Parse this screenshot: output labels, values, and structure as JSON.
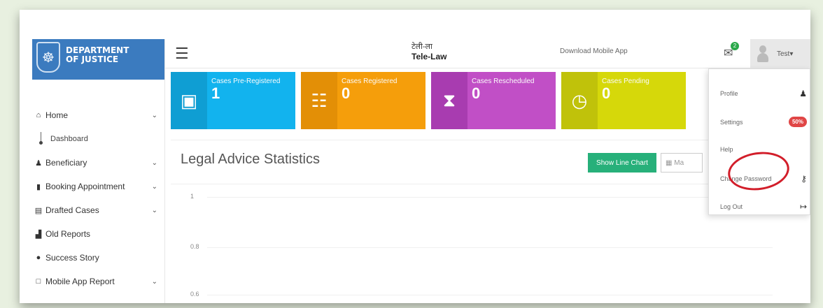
{
  "sidebar": {
    "logo_line1": "DEPARTMENT",
    "logo_line2": "OF JUSTICE",
    "items": [
      {
        "label": "Home",
        "icon": "home-icon",
        "glyph": "⌂",
        "chevron": true
      },
      {
        "label": "Beneficiary",
        "icon": "user-icon",
        "glyph": "♟",
        "chevron": true
      },
      {
        "label": "Booking Appointment",
        "icon": "bookmark-icon",
        "glyph": "▮",
        "chevron": true
      },
      {
        "label": "Drafted Cases",
        "icon": "book-icon",
        "glyph": "▤",
        "chevron": true
      },
      {
        "label": "Old Reports",
        "icon": "bar-chart-icon",
        "glyph": "▟",
        "chevron": false
      },
      {
        "label": "Success Story",
        "icon": "check-circle-icon",
        "glyph": "●",
        "chevron": false
      },
      {
        "label": "Mobile App Report",
        "icon": "square-icon",
        "glyph": "□",
        "chevron": true
      }
    ],
    "sub_item": "Dashboard"
  },
  "topbar": {
    "brand_hi": "टेली-ला",
    "brand_en": "Tele-Law",
    "download_app": "Download Mobile App",
    "mail_count": "2",
    "user_name": "Test▾"
  },
  "cards": [
    {
      "title": "Cases Pre-Registered",
      "value": "1",
      "color": "#12b3ee",
      "icon_bg": "#0f9ed3",
      "icon": "id-card-icon",
      "glyph": "▣"
    },
    {
      "title": "Cases Registered",
      "value": "0",
      "color": "#f59e0b",
      "icon_bg": "#e38f06",
      "icon": "clipboard-icon",
      "glyph": "☷"
    },
    {
      "title": "Cases Rescheduled",
      "value": "0",
      "color": "#c14fc6",
      "icon_bg": "#a83cb0",
      "icon": "hourglass-icon",
      "glyph": "⧗"
    },
    {
      "title": "Cases Pending",
      "value": "0",
      "color": "#d6d80a",
      "icon_bg": "#c0c20a",
      "icon": "clock-icon",
      "glyph": "◷"
    }
  ],
  "stats": {
    "title": "Legal Advice Statistics",
    "line_chart_button": "Show Line Chart",
    "select_value": "Ma",
    "y_ticks": [
      "1",
      "0.8",
      "0.6"
    ]
  },
  "dropdown": {
    "items": [
      {
        "label": "Profile",
        "icon": "user-icon",
        "glyph": "♟"
      },
      {
        "label": "Settings",
        "badge": "50%"
      },
      {
        "label": "Help"
      },
      {
        "label": "Change Password",
        "icon": "key-icon",
        "glyph": "⚷"
      },
      {
        "label": "Log Out",
        "icon": "sign-out-icon",
        "glyph": "↦"
      }
    ]
  },
  "colors": {
    "sidebar_logo": "#3b7bbf",
    "button_green": "#27b07a",
    "highlight_circle": "#d21e2a"
  }
}
